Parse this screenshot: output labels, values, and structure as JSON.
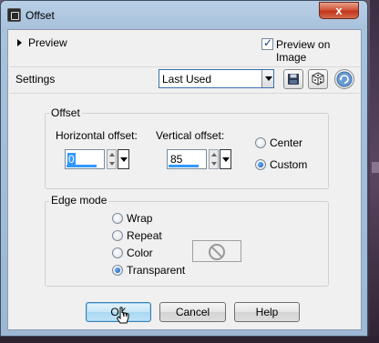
{
  "window": {
    "title": "Offset",
    "close_glyph": "x"
  },
  "preview": {
    "label": "Preview",
    "preview_on_image_label": "Preview on Image",
    "preview_on_image_checked": true
  },
  "settings": {
    "label": "Settings",
    "selected": "Last Used",
    "icons": [
      "save-preset-icon",
      "randomize-dice-icon",
      "reset-icon"
    ]
  },
  "offset": {
    "group_title": "Offset",
    "horizontal_label": "Horizontal offset:",
    "horizontal_value": "0",
    "vertical_label": "Vertical offset:",
    "vertical_value": "85",
    "center_label": "Center",
    "custom_label": "Custom",
    "selected_mode": "Custom"
  },
  "edge_mode": {
    "group_title": "Edge mode",
    "options": [
      "Wrap",
      "Repeat",
      "Color",
      "Transparent"
    ],
    "selected": "Transparent"
  },
  "buttons": {
    "ok": "OK",
    "cancel": "Cancel",
    "help": "Help"
  },
  "colors": {
    "title_bar": "#a9c2dc",
    "close_button": "#c8452b",
    "selection_blue": "#3399ff",
    "dialog_bg": "#f0f0f0"
  }
}
